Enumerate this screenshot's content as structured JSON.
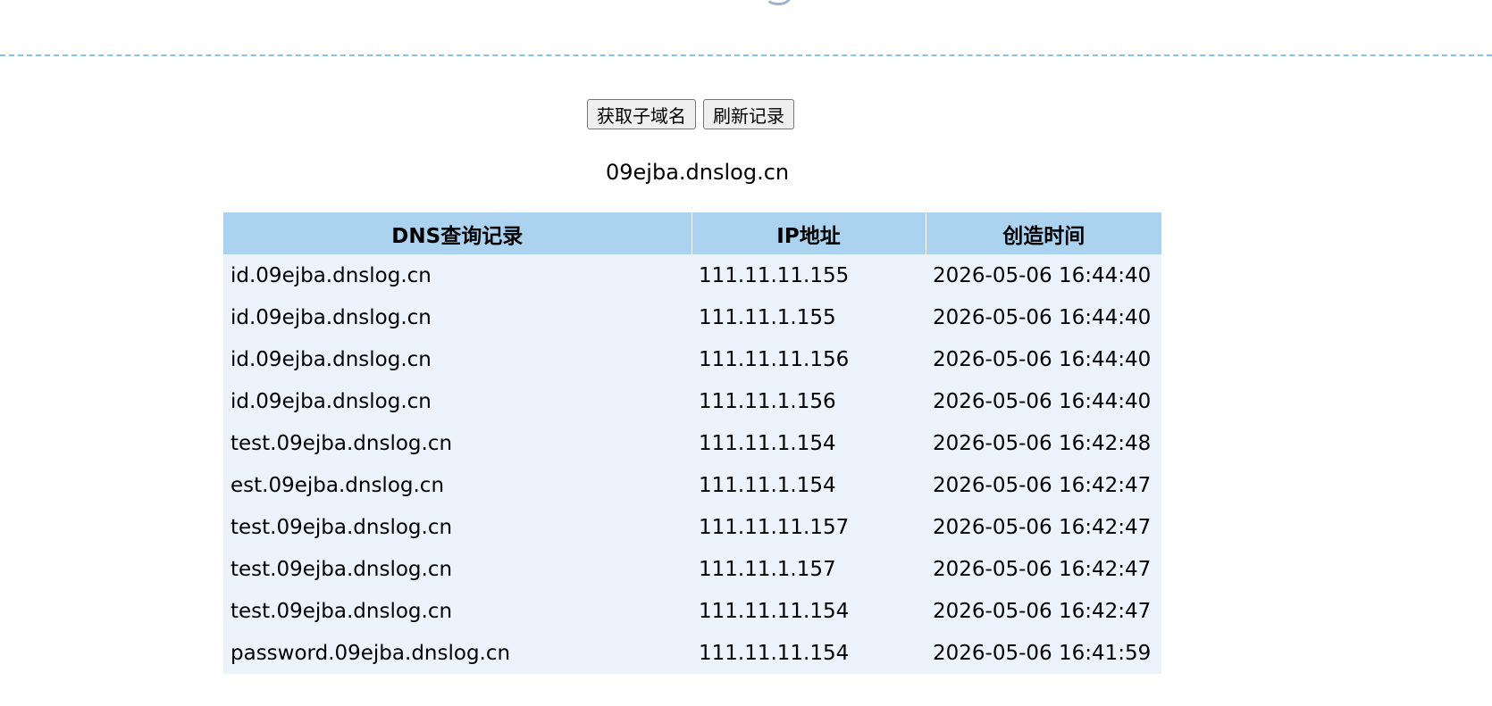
{
  "actions": {
    "get_subdomain_label": "获取子域名",
    "refresh_label": "刷新记录"
  },
  "subdomain": "09ejba.dnslog.cn",
  "table": {
    "headers": [
      "DNS查询记录",
      "IP地址",
      "创造时间"
    ],
    "rows": [
      [
        "id.09ejba.dnslog.cn",
        "111.11.11.155",
        "2026-05-06 16:44:40"
      ],
      [
        "id.09ejba.dnslog.cn",
        "111.11.1.155",
        "2026-05-06 16:44:40"
      ],
      [
        "id.09ejba.dnslog.cn",
        "111.11.11.156",
        "2026-05-06 16:44:40"
      ],
      [
        "id.09ejba.dnslog.cn",
        "111.11.1.156",
        "2026-05-06 16:44:40"
      ],
      [
        "test.09ejba.dnslog.cn",
        "111.11.1.154",
        "2026-05-06 16:42:48"
      ],
      [
        "est.09ejba.dnslog.cn",
        "111.11.1.154",
        "2026-05-06 16:42:47"
      ],
      [
        "test.09ejba.dnslog.cn",
        "111.11.11.157",
        "2026-05-06 16:42:47"
      ],
      [
        "test.09ejba.dnslog.cn",
        "111.11.1.157",
        "2026-05-06 16:42:47"
      ],
      [
        "test.09ejba.dnslog.cn",
        "111.11.11.154",
        "2026-05-06 16:42:47"
      ],
      [
        "password.09ejba.dnslog.cn",
        "111.11.11.154",
        "2026-05-06 16:41:59"
      ]
    ]
  },
  "colors": {
    "header_bg": "#abd3ef",
    "row_bg": "#edf3fd",
    "divider": "#87c4e4"
  }
}
